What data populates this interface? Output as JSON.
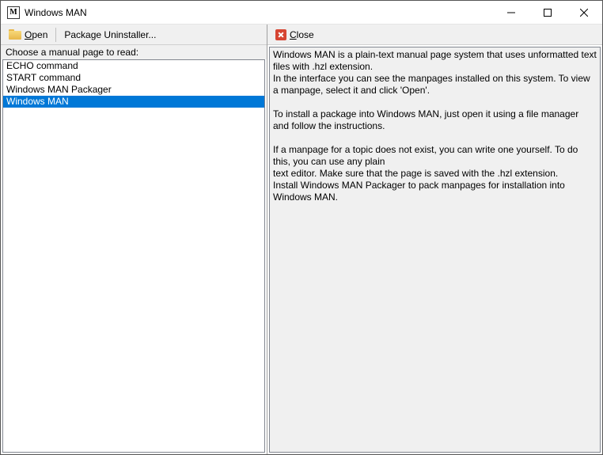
{
  "window": {
    "title": "Windows MAN",
    "icon_letter": "M"
  },
  "left": {
    "open_label": "Open",
    "uninstaller_label": "Package Uninstaller...",
    "prompt": "Choose a manual page to read:",
    "items": [
      {
        "label": "ECHO command",
        "selected": false
      },
      {
        "label": "START command",
        "selected": false
      },
      {
        "label": "Windows MAN Packager",
        "selected": false
      },
      {
        "label": "Windows MAN",
        "selected": true
      }
    ]
  },
  "right": {
    "close_label": "Close",
    "body": "Windows MAN is a plain-text manual page system that uses unformatted text files with .hzl extension.\nIn the interface you can see the manpages installed on this system. To view a manpage, select it and click 'Open'.\n\nTo install a package into Windows MAN, just open it using a file manager and follow the instructions.\n\nIf a manpage for a topic does not exist, you can write one yourself. To do this, you can use any plain\ntext editor. Make sure that the page is saved with the .hzl extension.\nInstall Windows MAN Packager to pack manpages for installation into Windows MAN."
  }
}
